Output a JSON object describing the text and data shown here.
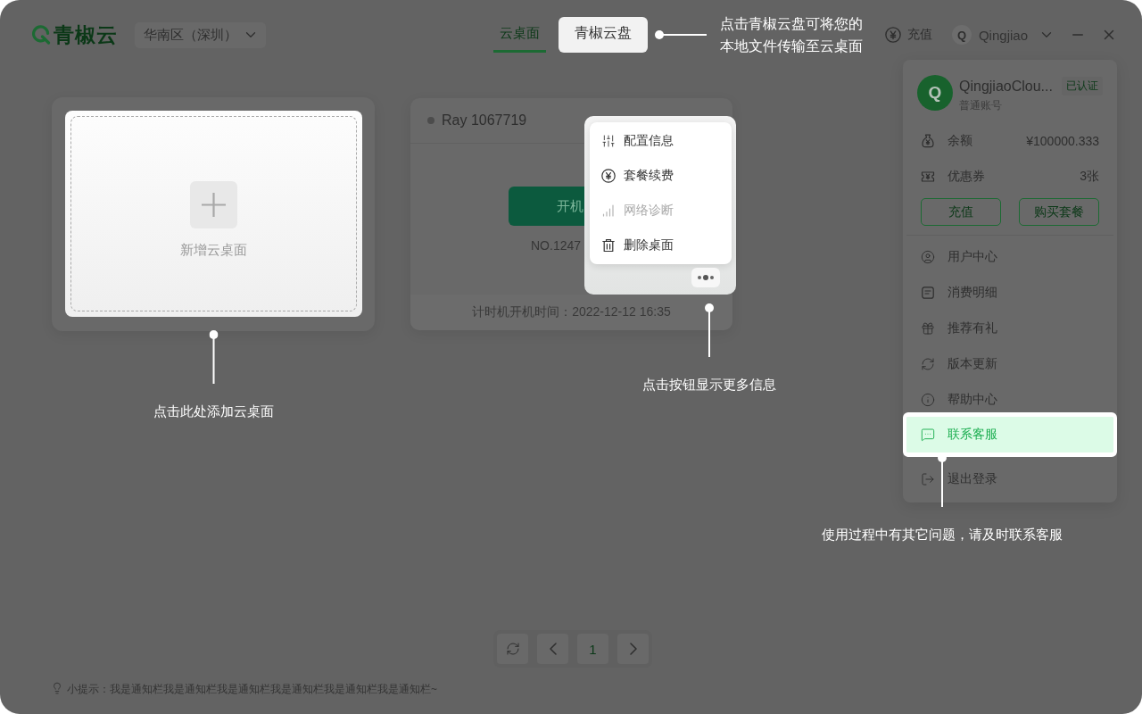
{
  "header": {
    "logo": "青椒云",
    "region": {
      "value": "华南区（深圳）"
    },
    "tabs": [
      {
        "label": "云桌面",
        "selected": true,
        "spotlight": false
      },
      {
        "label": "青椒云盘",
        "selected": false,
        "spotlight": true,
        "guide": "点击青椒云盘可将您的本地文件传输至云桌面"
      }
    ],
    "recharge": "充值",
    "user": {
      "avatar": "Q",
      "name": "Qingjiao"
    }
  },
  "add_card": {
    "label": "新增云桌面",
    "spotlight": true,
    "guide": "点击此处添加云桌面"
  },
  "desktops": [
    {
      "name": "Ray 1067719",
      "power_button": "开机",
      "number": "NO.1247",
      "footer": "计时机开机时间：2022-12-12 16:35",
      "more_button": {
        "spotlight": true,
        "guide": "点击按钮显示更多信息"
      },
      "menu": {
        "open": true,
        "items": [
          {
            "label": "配置信息",
            "disabled": false
          },
          {
            "label": "套餐续费",
            "disabled": false
          },
          {
            "label": "网络诊断",
            "disabled": true
          },
          {
            "label": "删除桌面",
            "disabled": false
          }
        ]
      }
    }
  ],
  "account_panel": {
    "open": true,
    "avatar": "Q",
    "name": "QingjiaoClou...",
    "badge": "已认证",
    "account_type": "普通账号",
    "stats": [
      {
        "label": "余额",
        "value": "¥100000.333"
      },
      {
        "label": "优惠券",
        "value": "3张"
      }
    ],
    "buttons": [
      "充值",
      "购买套餐"
    ],
    "menu": [
      {
        "label": "用户中心",
        "spotlight": false
      },
      {
        "label": "消费明细",
        "spotlight": false
      },
      {
        "label": "推荐有礼",
        "spotlight": false
      },
      {
        "label": "版本更新",
        "spotlight": false
      },
      {
        "label": "帮助中心",
        "spotlight": false
      },
      {
        "label": "联系客服",
        "spotlight": true,
        "guide": "使用过程中有其它问题，请及时联系客服"
      },
      {
        "label": "退出登录",
        "spotlight": false
      }
    ]
  },
  "pagination": {
    "pages": [
      {
        "label": "1",
        "selected": true
      }
    ]
  },
  "footer": {
    "hint": "小提示：我是通知栏我是通知栏我是通知栏我是通知栏我是通知栏我是通知栏~"
  }
}
